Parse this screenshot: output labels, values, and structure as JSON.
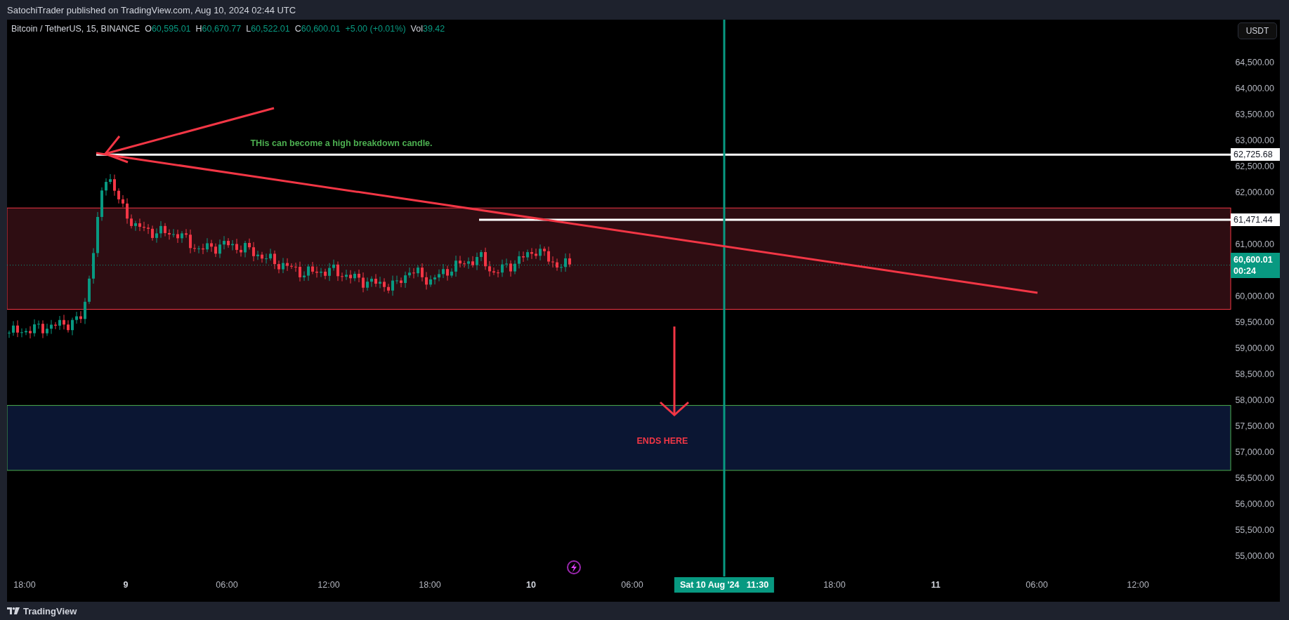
{
  "header": {
    "text": "SatochiTrader published on TradingView.com, Aug 10, 2024 02:44 UTC"
  },
  "legend": {
    "symbol": "Bitcoin / TetherUS, 15, BINANCE",
    "ohlc": [
      {
        "label": "O",
        "value": "60,595.01"
      },
      {
        "label": "H",
        "value": "60,670.77"
      },
      {
        "label": "L",
        "value": "60,522.01"
      },
      {
        "label": "C",
        "value": "60,600.01"
      }
    ],
    "change": "+5.00 (+0.01%)",
    "volume": {
      "label": "Vol",
      "value": "39.42"
    }
  },
  "currency_button": "USDT",
  "price_axis": [
    "64,500.00",
    "64,000.00",
    "63,500.00",
    "63,000.00",
    "62,500.00",
    "62,000.00",
    "61,000.00",
    "60,000.00",
    "59,500.00",
    "59,000.00",
    "58,500.00",
    "58,000.00",
    "57,500.00",
    "57,000.00",
    "56,500.00",
    "56,000.00",
    "55,500.00",
    "55,000.00"
  ],
  "price_labels": [
    {
      "kind": "line",
      "value": "62,725.68"
    },
    {
      "kind": "line",
      "value": "61,471.44"
    },
    {
      "kind": "last",
      "value": "60,600.01",
      "countdown": "00:24"
    }
  ],
  "time_axis": [
    {
      "kind": "tick",
      "label": "18:00"
    },
    {
      "kind": "day",
      "label": "9"
    },
    {
      "kind": "tick",
      "label": "06:00"
    },
    {
      "kind": "tick",
      "label": "12:00"
    },
    {
      "kind": "tick",
      "label": "18:00"
    },
    {
      "kind": "day",
      "label": "10"
    },
    {
      "kind": "tick",
      "label": "06:00"
    },
    {
      "kind": "cursor",
      "label": "Sat 10 Aug '24   11:30"
    },
    {
      "kind": "tick",
      "label": "18:00"
    },
    {
      "kind": "day",
      "label": "11"
    },
    {
      "kind": "tick",
      "label": "06:00"
    },
    {
      "kind": "tick",
      "label": "12:00"
    }
  ],
  "annotations": [
    {
      "text": "THis can become a high breakdown candle.",
      "color": "#4caf50"
    },
    {
      "text": "ENDS HERE",
      "color": "#f23645"
    }
  ],
  "footer": {
    "brand": "TradingView"
  }
}
